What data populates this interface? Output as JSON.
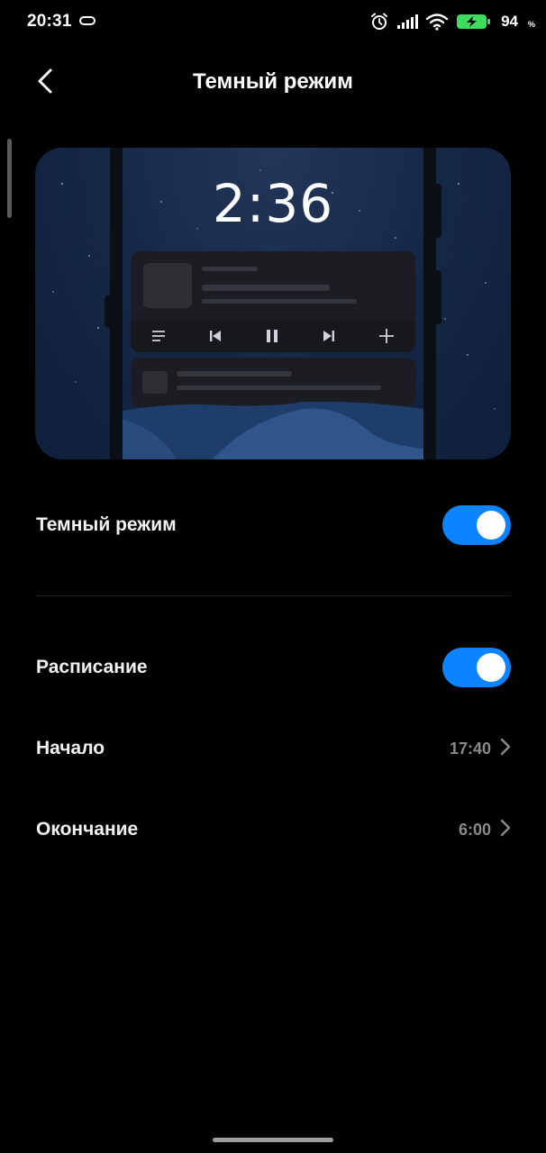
{
  "status_bar": {
    "time": "20:31",
    "battery_percent": "94",
    "battery_sign": "%",
    "icons": [
      "alarm-icon",
      "signal-icon",
      "wifi-icon",
      "battery-charging-icon"
    ]
  },
  "header": {
    "title": "Темный режим",
    "back_icon": "chevron-left-icon"
  },
  "preview": {
    "clock": "2:36",
    "media_controls": [
      "playlist-icon",
      "previous-icon",
      "pause-icon",
      "next-icon",
      "plus-icon"
    ]
  },
  "settings": {
    "dark_mode": {
      "label": "Темный режим",
      "enabled": true
    },
    "schedule": {
      "label": "Расписание",
      "enabled": true
    },
    "start": {
      "label": "Начало",
      "value": "17:40"
    },
    "end": {
      "label": "Окончание",
      "value": "6:00"
    }
  },
  "colors": {
    "accent": "#0d84ff",
    "background": "#000000",
    "value_text": "#8a8a8a",
    "battery": "#3ddc5c"
  }
}
